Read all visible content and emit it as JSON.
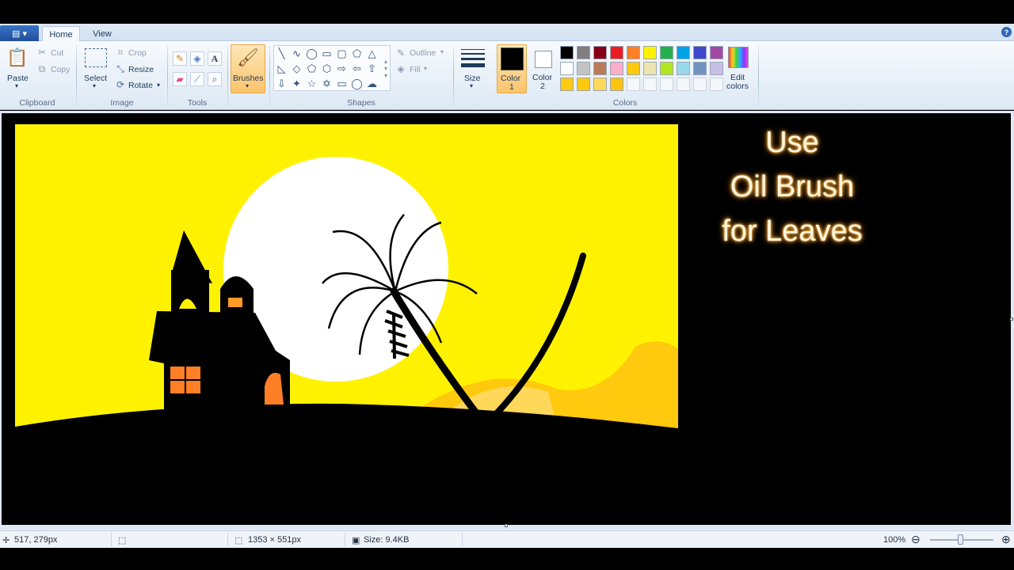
{
  "tabs": {
    "file_icon": "file-menu-icon",
    "home": "Home",
    "view": "View",
    "help_glyph": "?"
  },
  "clipboard": {
    "paste": "Paste",
    "cut": "Cut",
    "copy": "Copy",
    "label": "Clipboard"
  },
  "image": {
    "select": "Select",
    "crop": "Crop",
    "resize": "Resize",
    "rotate": "Rotate",
    "label": "Image"
  },
  "tools": {
    "label": "Tools"
  },
  "brushes": {
    "label": "Brushes"
  },
  "shapes": {
    "outline": "Outline",
    "fill": "Fill",
    "label": "Shapes"
  },
  "size": {
    "label": "Size"
  },
  "colors": {
    "color1_line1": "Color",
    "color1_line2": "1",
    "color2_line1": "Color",
    "color2_line2": "2",
    "edit_line1": "Edit",
    "edit_line2": "colors",
    "label": "Colors",
    "color1_value": "#000000",
    "color2_value": "#ffffff",
    "palette_row1": [
      "#000000",
      "#7f7f7f",
      "#880015",
      "#ed1c24",
      "#ff7f27",
      "#fff200",
      "#22b14c",
      "#00a2e8",
      "#3f48cc",
      "#a349a4"
    ],
    "palette_row2": [
      "#ffffff",
      "#c3c3c3",
      "#b97a57",
      "#ffaec9",
      "#ffc90e",
      "#efe4b0",
      "#b5e61d",
      "#99d9ea",
      "#7092be",
      "#c8bfe7"
    ],
    "palette_row3": [
      "#ffc90e",
      "#ffc90e",
      "#ffd85a",
      "#ffc20e"
    ]
  },
  "overlay": {
    "line1": "Use",
    "line2": "Oil Brush",
    "line3": "for Leaves"
  },
  "status": {
    "cursor": "517, 279px",
    "dimensions": "1353 × 551px",
    "size": "Size: 9.4KB",
    "zoom": "100%"
  }
}
